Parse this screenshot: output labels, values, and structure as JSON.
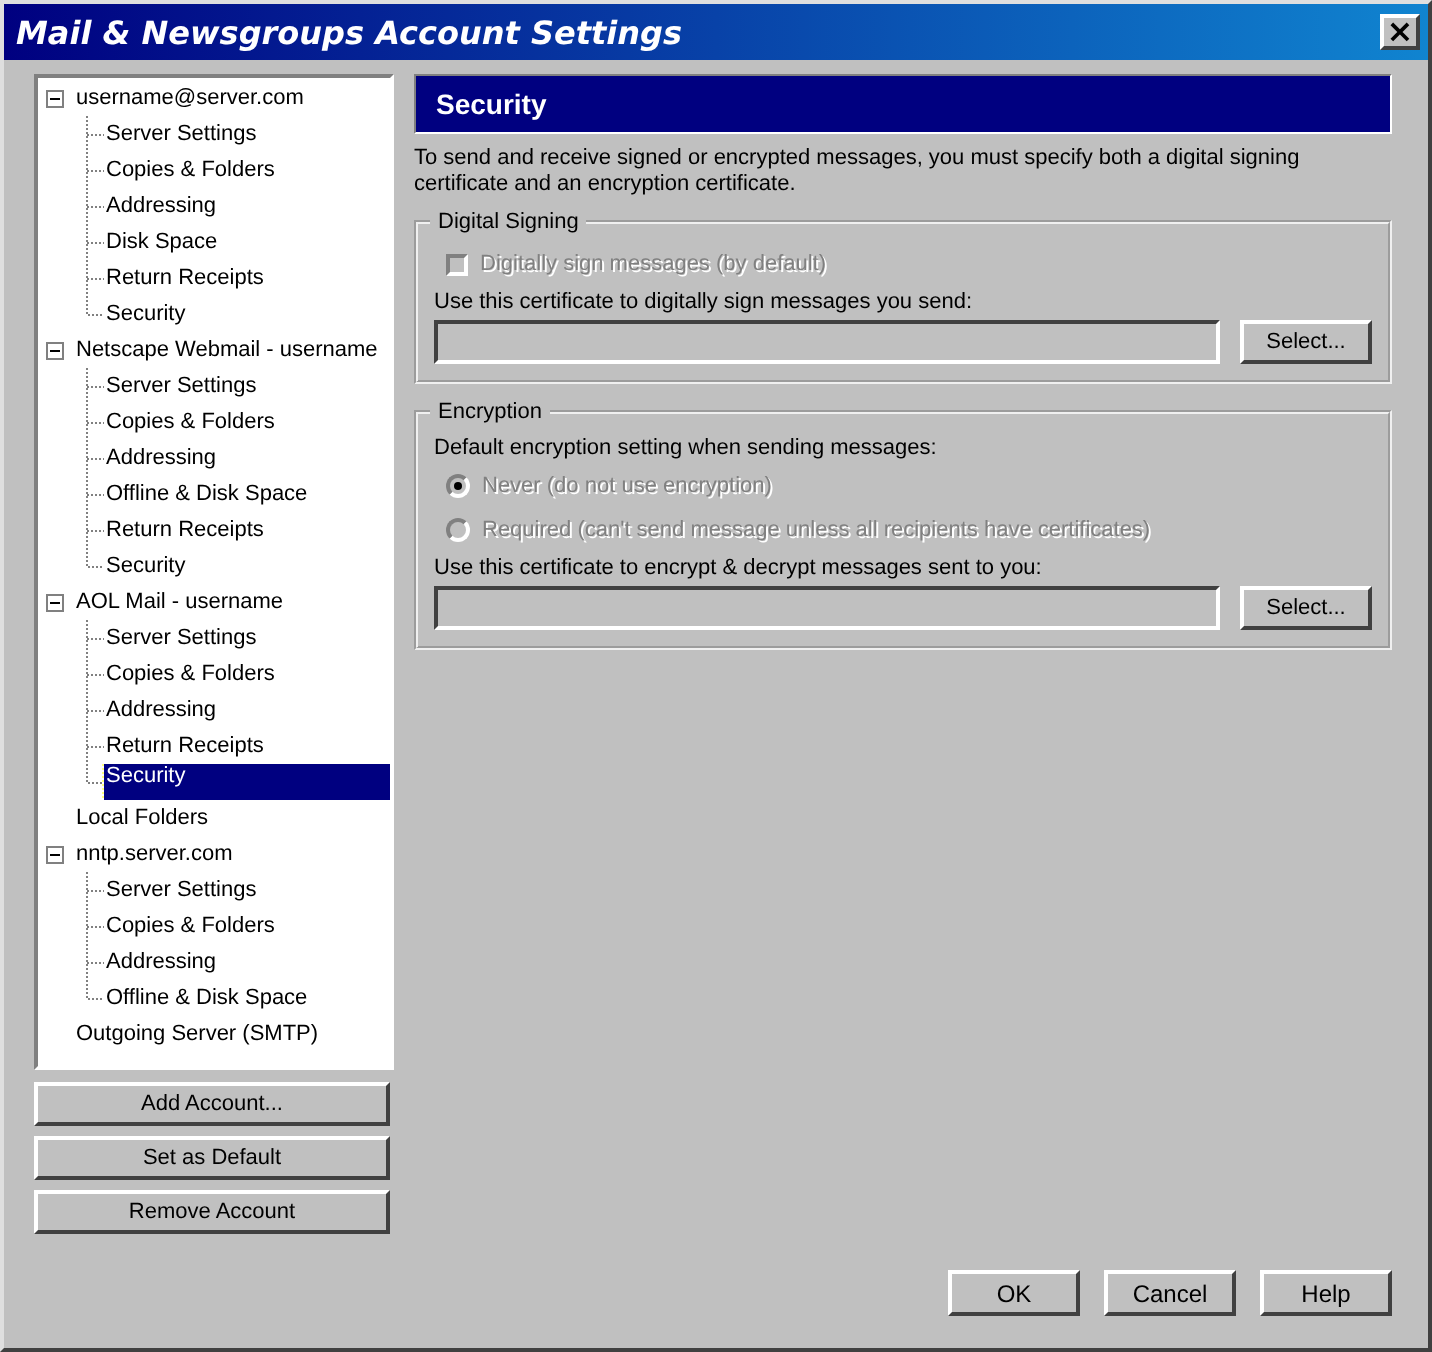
{
  "window": {
    "title": "Mail & Newsgroups Account Settings",
    "close": "×"
  },
  "tree": [
    {
      "label": "username@server.com",
      "expanded": true,
      "selected": false,
      "children": [
        {
          "label": "Server Settings",
          "selected": false
        },
        {
          "label": "Copies & Folders",
          "selected": false
        },
        {
          "label": "Addressing",
          "selected": false
        },
        {
          "label": "Disk Space",
          "selected": false
        },
        {
          "label": "Return Receipts",
          "selected": false
        },
        {
          "label": "Security",
          "selected": false
        }
      ]
    },
    {
      "label": "Netscape Webmail - username",
      "expanded": true,
      "selected": false,
      "children": [
        {
          "label": "Server Settings",
          "selected": false
        },
        {
          "label": "Copies & Folders",
          "selected": false
        },
        {
          "label": "Addressing",
          "selected": false
        },
        {
          "label": "Offline & Disk Space",
          "selected": false
        },
        {
          "label": "Return Receipts",
          "selected": false
        },
        {
          "label": "Security",
          "selected": false
        }
      ]
    },
    {
      "label": "AOL Mail - username",
      "expanded": true,
      "selected": false,
      "children": [
        {
          "label": "Server Settings",
          "selected": false
        },
        {
          "label": "Copies & Folders",
          "selected": false
        },
        {
          "label": "Addressing",
          "selected": false
        },
        {
          "label": "Return Receipts",
          "selected": false
        },
        {
          "label": "Security",
          "selected": true
        }
      ]
    },
    {
      "label": "Local Folders",
      "selected": false
    },
    {
      "label": "nntp.server.com",
      "expanded": true,
      "selected": false,
      "children": [
        {
          "label": "Server Settings",
          "selected": false
        },
        {
          "label": "Copies & Folders",
          "selected": false
        },
        {
          "label": "Addressing",
          "selected": false
        },
        {
          "label": "Offline & Disk Space",
          "selected": false
        }
      ]
    },
    {
      "label": "Outgoing Server (SMTP)",
      "selected": false
    }
  ],
  "account_buttons": [
    "Add Account...",
    "Set as Default",
    "Remove Account"
  ],
  "panel": {
    "title": "Security",
    "intro": "To send and receive signed or encrypted messages, you must specify both a digital signing certificate and an encryption certificate.",
    "signing": {
      "title": "Digital Signing",
      "checkbox": {
        "label": "Digitally sign messages (by default)",
        "checked": false,
        "disabled": true
      },
      "cert_label": "Use this certificate to digitally sign messages you send:",
      "button": "Select..."
    },
    "encryption": {
      "title": "Encryption",
      "setting_label": "Default encryption setting when sending messages:",
      "options": [
        {
          "label": "Never (do not use encryption)",
          "selected": true,
          "disabled": true
        },
        {
          "label": "Required (can't send message unless all recipients have certificates)",
          "selected": false,
          "disabled": true
        }
      ],
      "cert_label": "Use this certificate to encrypt & decrypt messages sent to you:",
      "button": "Select..."
    }
  },
  "dialog_buttons": [
    "OK",
    "Cancel",
    "Help"
  ]
}
